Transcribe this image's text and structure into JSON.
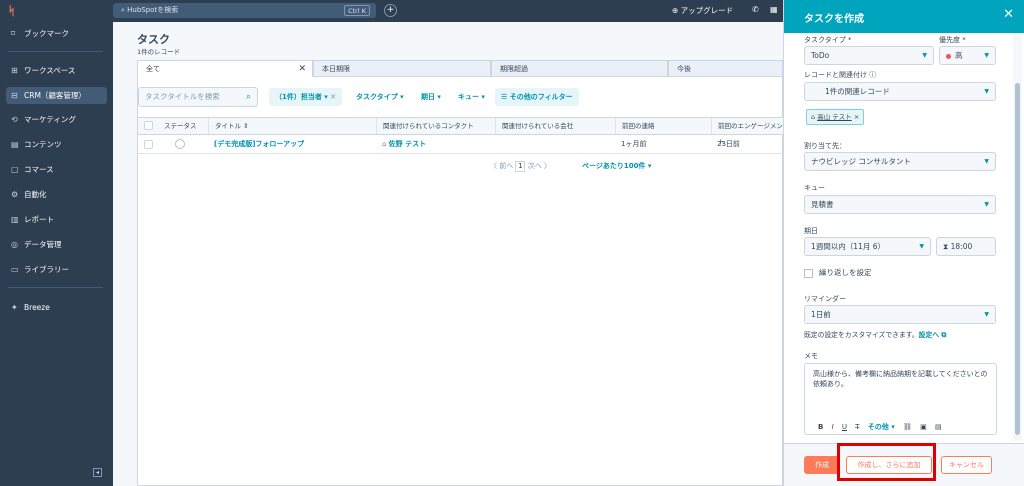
{
  "topbar": {
    "logo": "ᛋ",
    "search_placeholder": "HubSpotを検索",
    "search_shortcut": "Ctrl K",
    "plus": "+",
    "upgrade": "アップグレード"
  },
  "sidebar": {
    "items": [
      {
        "icon": "⌑",
        "label": "ブックマーク"
      },
      {
        "icon": "⊞",
        "label": "ワークスペース"
      },
      {
        "icon": "⊟",
        "label": "CRM（顧客管理）"
      },
      {
        "icon": "⟲",
        "label": "マーケティング"
      },
      {
        "icon": "▤",
        "label": "コンテンツ"
      },
      {
        "icon": "▢",
        "label": "コマース"
      },
      {
        "icon": "⚙",
        "label": "自動化"
      },
      {
        "icon": "▥",
        "label": "レポート"
      },
      {
        "icon": "◎",
        "label": "データ管理"
      },
      {
        "icon": "▭",
        "label": "ライブラリー"
      },
      {
        "icon": "✦",
        "label": "Breeze"
      }
    ],
    "collapse": "◂"
  },
  "main": {
    "title": "タスク",
    "subtitle": "1件のレコード",
    "tabs": [
      {
        "label": "全て",
        "close": "✕"
      },
      {
        "label": "本日期限"
      },
      {
        "label": "期限超過"
      },
      {
        "label": "今後"
      }
    ],
    "search_placeholder": "タスクタイトルを検索",
    "filters": [
      {
        "label": "（1件）担当者 ▾",
        "close": "✕"
      },
      {
        "label": "タスクタイプ ▾"
      },
      {
        "label": "期日 ▾"
      },
      {
        "label": "キュー ▾"
      },
      {
        "label": "☰ その他のフィルター"
      }
    ],
    "columns": [
      "ステータス",
      "タイトル ⇕",
      "関連付けられているコンタクト",
      "関連付けられている会社",
      "前回の連絡",
      "前回のエンゲージメント"
    ],
    "rows": [
      {
        "title": "[デモ完成版]フォローアップ",
        "contact": "佐野 テスト",
        "company": "",
        "last_contact": "1ヶ月前",
        "last_engagement": "23日前"
      }
    ],
    "pagination": {
      "prev": "〈 前へ",
      "page": "1",
      "next": "次へ 〉",
      "per_page": "ページあたり100件 ▾"
    }
  },
  "drawer": {
    "title": "タスクを作成",
    "close": "✕",
    "task_type_label": "タスクタイプ *",
    "task_type_value": "ToDo",
    "priority_label": "優先度 *",
    "priority_value": "高",
    "record_assoc_label": "レコードと関連付け ⓘ",
    "record_assoc_value": "1件の関連レコード",
    "assoc_tag": "高山 テスト",
    "assoc_tag_close": "×",
    "assignee_label": "割り当て先：",
    "assignee_value": "ナウビレッジ コンサルタント",
    "queue_label": "キュー",
    "queue_value": "見積書",
    "due_label": "期日",
    "due_value": "1週間以内（11月 6）",
    "due_time": "18:00",
    "repeat_label": "繰り返しを設定",
    "reminder_label": "リマインダー",
    "reminder_value": "1日前",
    "hint_text": "既定の設定をカスタマイズできます。",
    "hint_link": "設定へ ⧉",
    "memo_label": "メモ",
    "memo_text": "高山様から、備考欄に納品納期を記載してくださいとの依頼あり。",
    "memo_tools": [
      "B",
      "I",
      "U",
      "T̶",
      "その他 ▾",
      "⛓",
      "▣",
      "▤"
    ],
    "buttons": {
      "create": "作成",
      "create_add": "作成し、さらに追加",
      "cancel": "キャンセル"
    }
  },
  "colors": {
    "brand": "#ff7a59",
    "header": "#00a4bd",
    "nav": "#2d3e50",
    "highlight": "#e00000"
  }
}
